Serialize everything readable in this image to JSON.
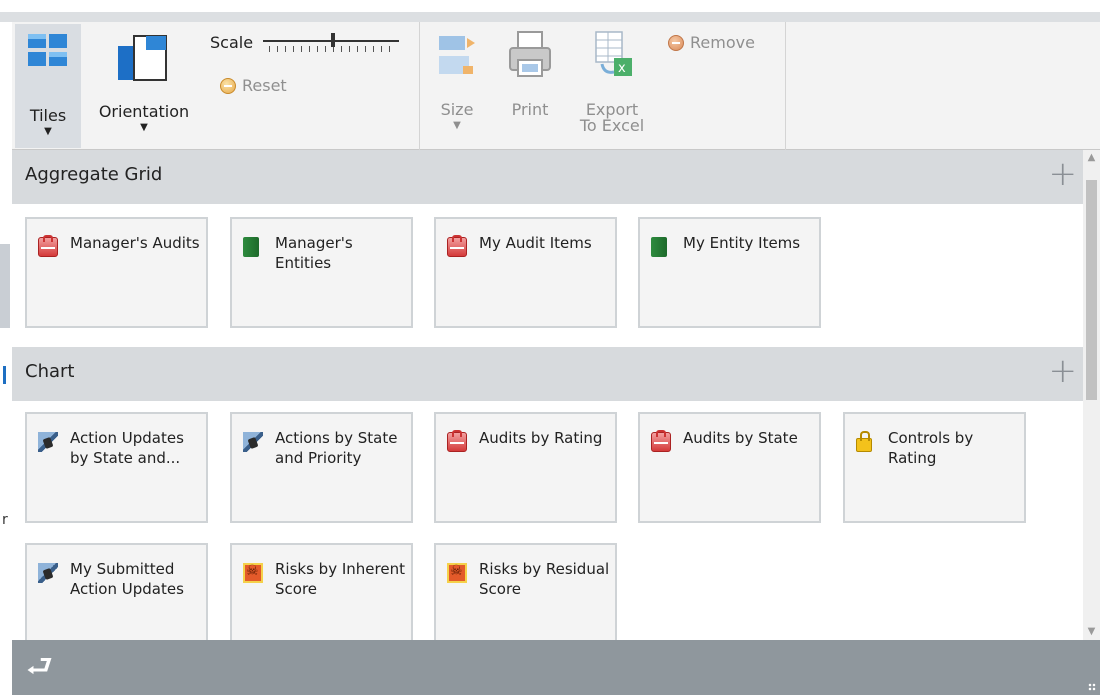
{
  "ribbon": {
    "tiles_label": "Tiles",
    "orientation_label": "Orientation",
    "scale_label": "Scale",
    "reset_label": "Reset",
    "size_label": "Size",
    "print_label": "Print",
    "export_label_line1": "Export",
    "export_label_line2": "To Excel",
    "remove_label": "Remove"
  },
  "sections": {
    "aggregate": {
      "title": "Aggregate Grid",
      "tiles": [
        {
          "label": "Manager's Audits",
          "icon": "audit-icon"
        },
        {
          "label": "Manager's Entities",
          "icon": "entity-icon"
        },
        {
          "label": "My Audit Items",
          "icon": "audit-icon"
        },
        {
          "label": "My Entity Items",
          "icon": "entity-icon"
        }
      ]
    },
    "chart": {
      "title": "Chart",
      "tiles": [
        {
          "label": "Action Updates by State and...",
          "icon": "action-update-icon"
        },
        {
          "label": "Actions by State and Priority",
          "icon": "action-icon"
        },
        {
          "label": "Audits by Rating",
          "icon": "audit-icon"
        },
        {
          "label": "Audits by State",
          "icon": "audit-icon"
        },
        {
          "label": "Controls by Rating",
          "icon": "control-lock-icon"
        },
        {
          "label": "My Submitted Action Updates",
          "icon": "action-update-icon"
        },
        {
          "label": "Risks by Inherent Score",
          "icon": "risk-icon"
        },
        {
          "label": "Risks by Residual Score",
          "icon": "risk-icon"
        }
      ]
    }
  },
  "left_edge_text": "r",
  "colors": {
    "section_header": "#d7dadd",
    "tile_bg": "#f4f4f4",
    "footer": "#8f979d",
    "accent": "#1e6fc2"
  }
}
